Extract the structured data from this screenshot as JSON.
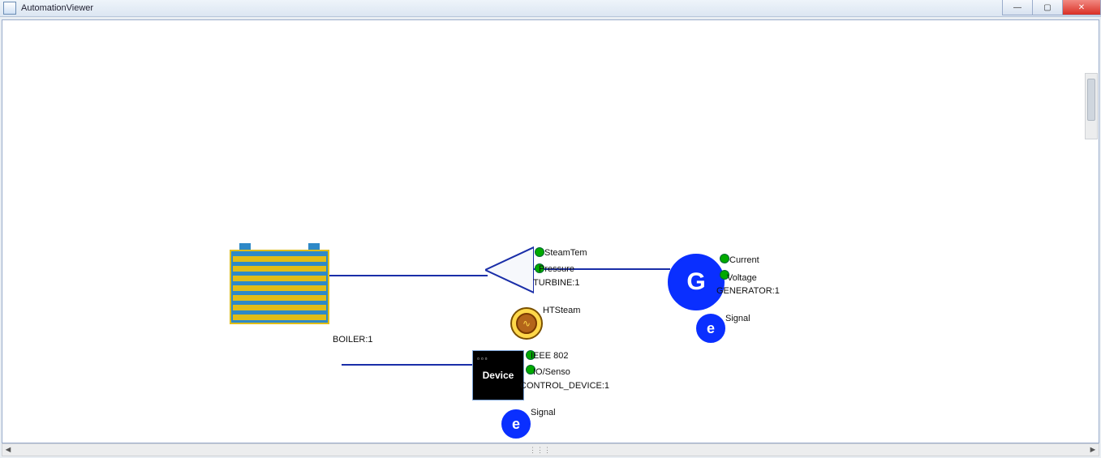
{
  "window": {
    "title": "AutomationViewer"
  },
  "nodes": {
    "boiler": {
      "label": "BOILER:1"
    },
    "turbine": {
      "label": "TURBINE:1",
      "ports": {
        "steamtem": "SteamTem",
        "pressure": "Pressure"
      }
    },
    "htsteam": {
      "label": "HTSteam"
    },
    "device": {
      "caption": "Device",
      "label": "CONTROL_DEVICE:1",
      "ports": {
        "ieee": "IEEE 802",
        "io": "IO/Senso"
      }
    },
    "device_signal": {
      "glyph": "e",
      "label": "Signal"
    },
    "generator": {
      "glyph": "G",
      "label": "GENERATOR:1",
      "ports": {
        "current": "Current",
        "voltage": "Voltage"
      }
    },
    "gen_signal": {
      "glyph": "e",
      "label": "Signal"
    }
  }
}
